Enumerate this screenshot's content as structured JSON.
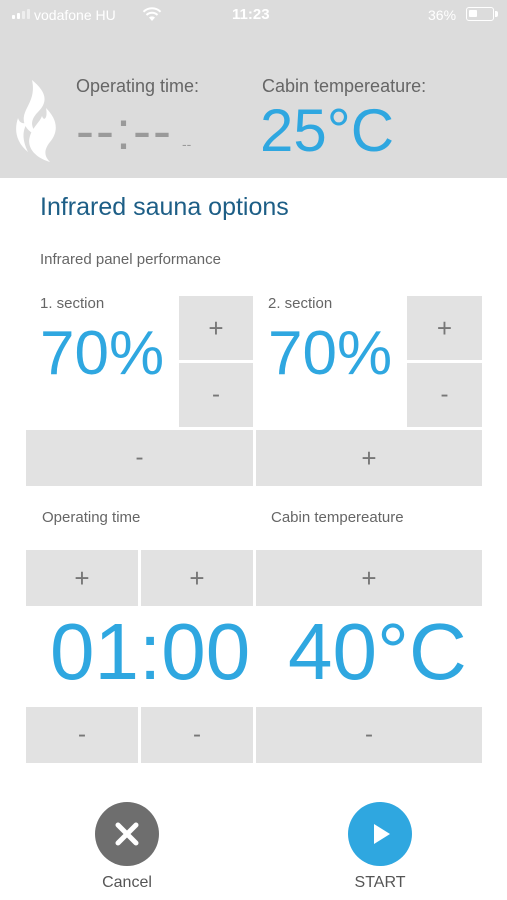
{
  "status_bar": {
    "carrier": "vodafone HU",
    "time": "11:23",
    "battery_percent": "36%",
    "battery_level": 0.36
  },
  "header": {
    "operating_time_label": "Operating time:",
    "operating_time_value": "--:--",
    "operating_time_sub": "--",
    "cabin_temp_label": "Cabin tempereature:",
    "cabin_temp_value": "25°C"
  },
  "main": {
    "title": "Infrared sauna options",
    "panel_performance_label": "Infrared panel performance",
    "section1": {
      "label": "1. section",
      "value": "70%",
      "plus": "+",
      "minus": "-"
    },
    "section2": {
      "label": "2. section",
      "value": "70%",
      "plus": "+",
      "minus": "-"
    },
    "all_minus": "-",
    "all_plus": "+",
    "operating_time": {
      "label": "Operating time",
      "value": "01:00",
      "hours_plus": "+",
      "minutes_plus": "+",
      "hours_minus": "-",
      "minutes_minus": "-"
    },
    "cabin_temp": {
      "label": "Cabin tempereature",
      "value": "40°C",
      "plus": "+",
      "minus": "-"
    }
  },
  "footer": {
    "cancel_label": "Cancel",
    "start_label": "START"
  },
  "colors": {
    "accent": "#2fa7e0",
    "title": "#1d5e86",
    "button_bg": "#e2e2e2",
    "header_bg": "#dcdcdc",
    "cancel_bg": "#6e6e6e"
  },
  "icons": [
    "signal-icon",
    "wifi-icon",
    "battery-icon",
    "flame-logo-icon",
    "close-icon",
    "play-icon"
  ]
}
